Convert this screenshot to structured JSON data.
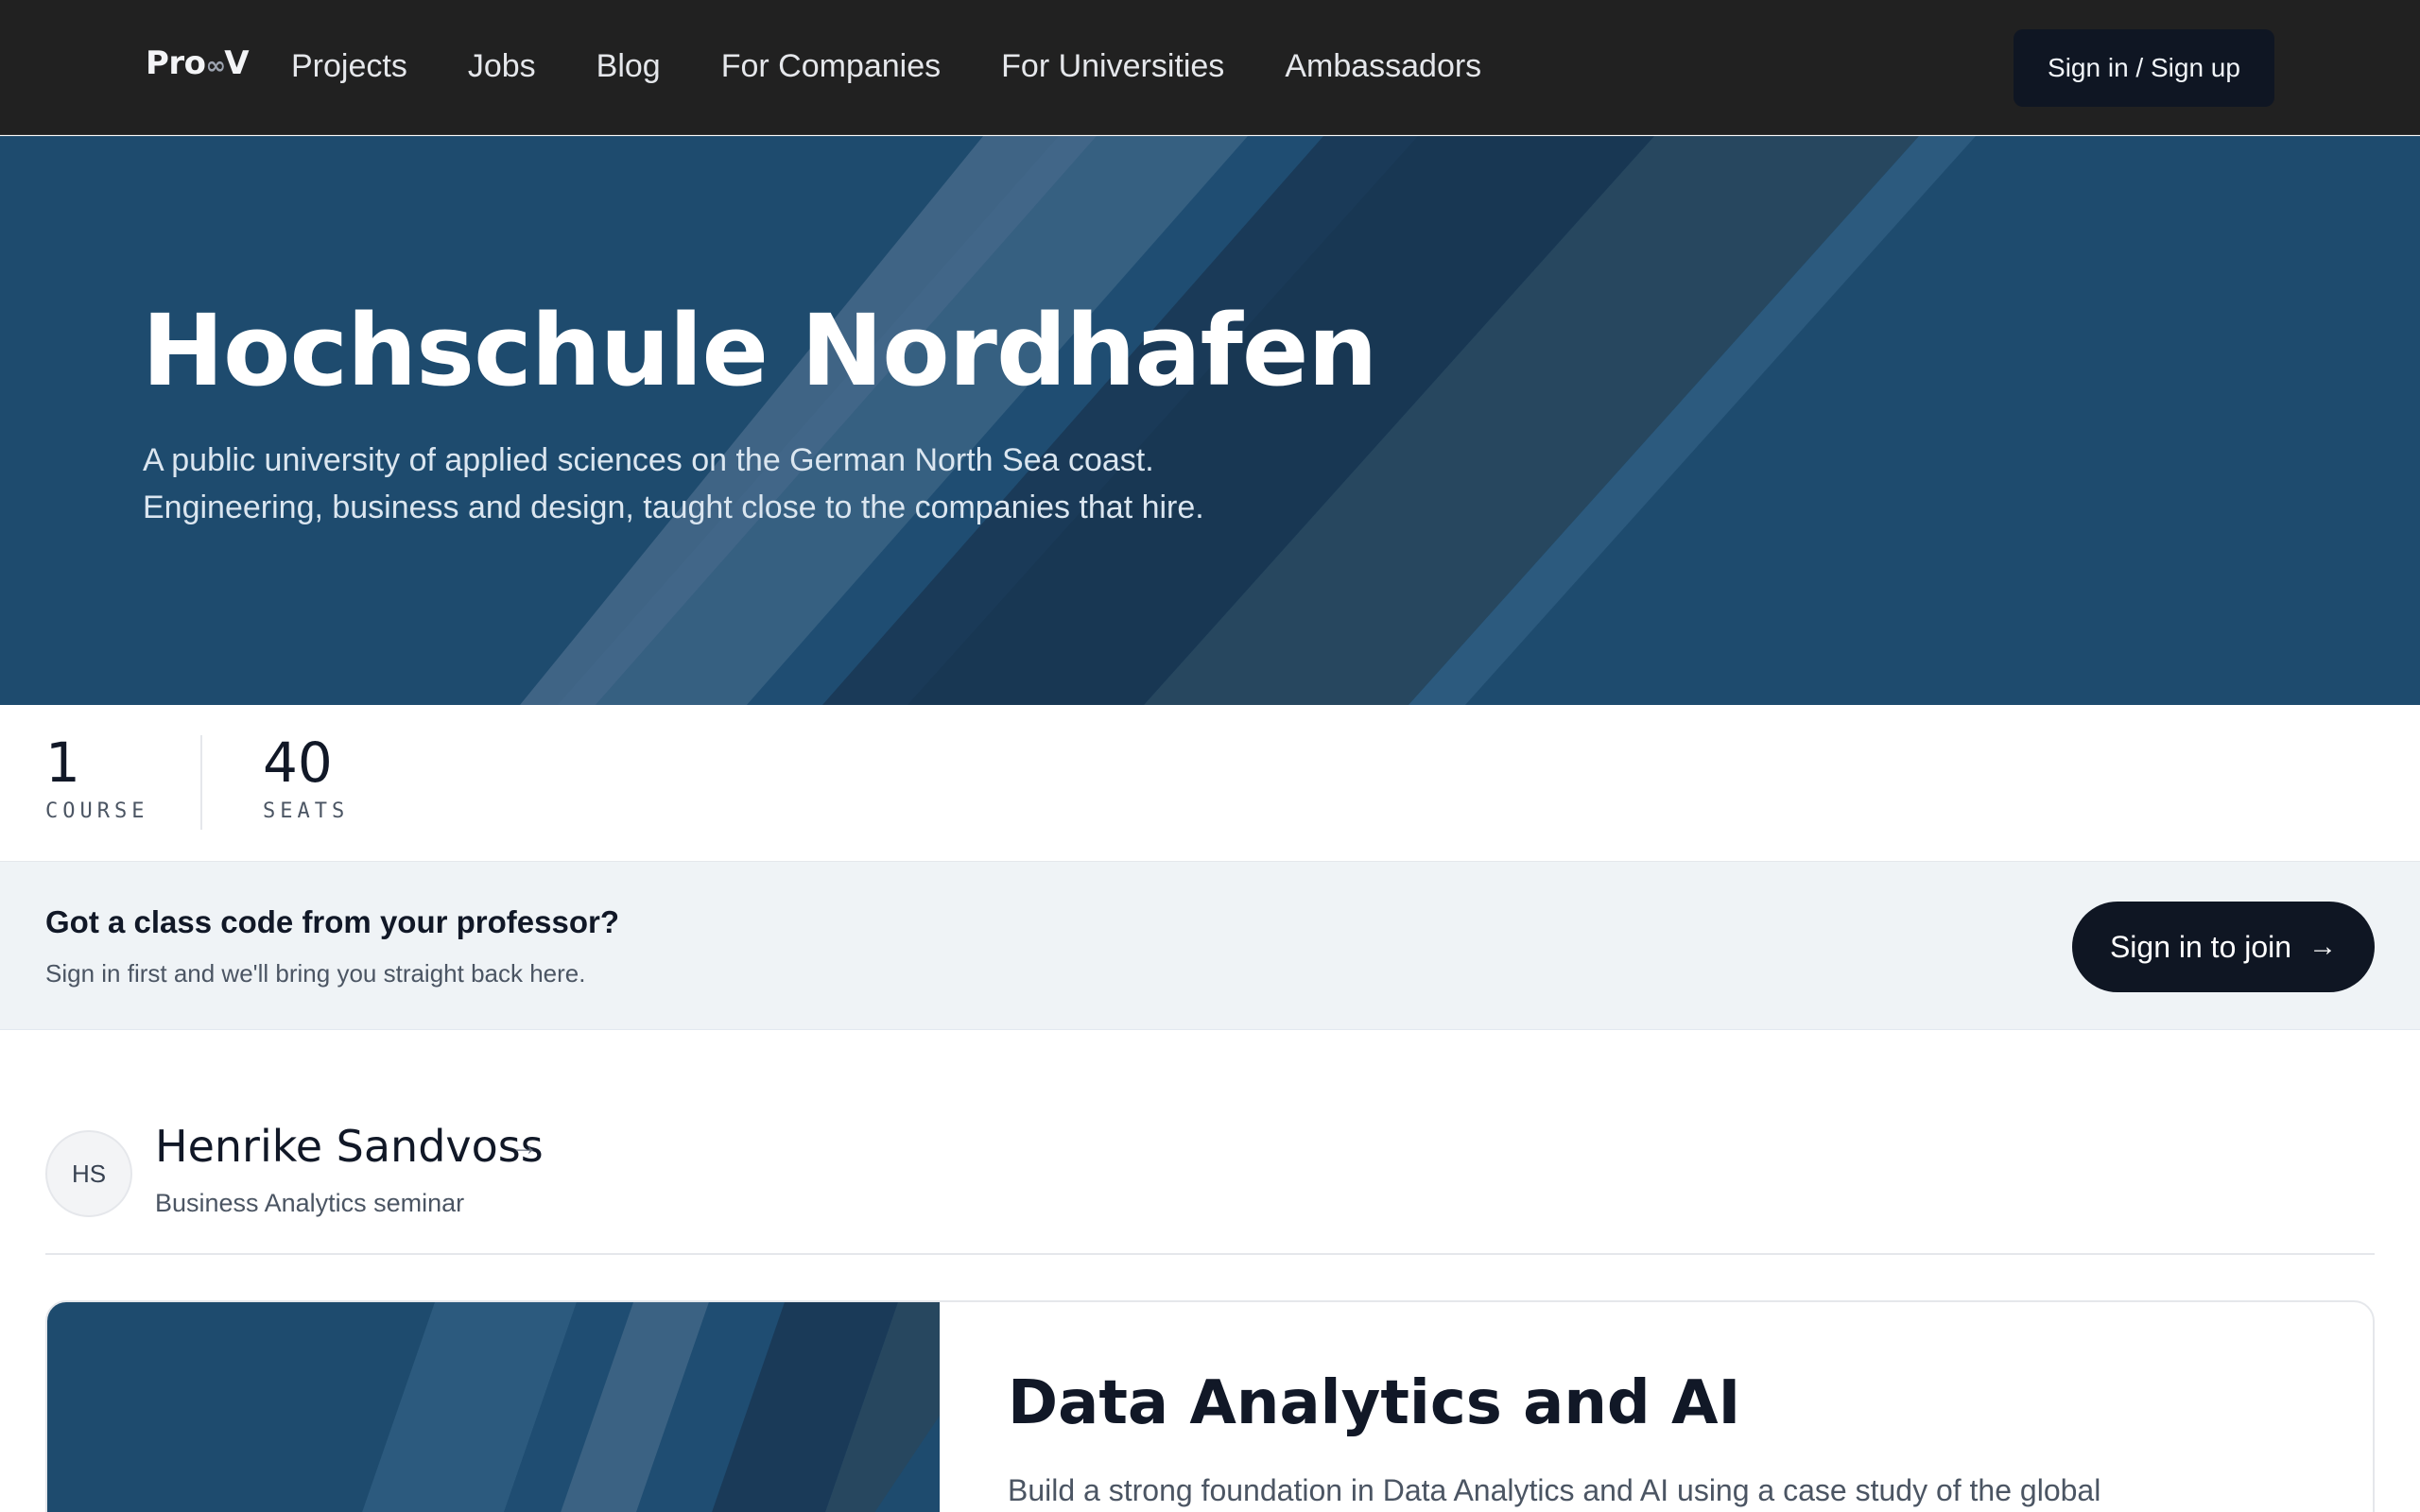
{
  "navbar": {
    "logo_left": "Pro",
    "logo_loop": "∞",
    "logo_right": "V",
    "links": [
      "Projects",
      "Jobs",
      "Blog",
      "For Companies",
      "For Universities",
      "Ambassadors"
    ],
    "signin_label": "Sign in / Sign up"
  },
  "hero": {
    "title": "Hochschule Nordhafen",
    "subtitle_line1": "A public university of applied sciences on the German North Sea coast.",
    "subtitle_line2": "Engineering, business and design, taught close to the companies that hire."
  },
  "stats": {
    "courses": {
      "value": "1",
      "label": "COURSE"
    },
    "seats": {
      "value": "40",
      "label": "SEATS"
    }
  },
  "class_code": {
    "title": "Got a class code from your professor?",
    "subtitle": "Sign in first and we'll bring you straight back here.",
    "button_label": "Sign in to join",
    "button_arrow": "→"
  },
  "instructor": {
    "initials": "HS",
    "name": "Henrike Sandvoss",
    "arrow": "→",
    "subtitle": "Business Analytics seminar"
  },
  "course": {
    "title": "Data Analytics and AI",
    "description": "Build a strong foundation in Data Analytics and AI using a case study of the global"
  },
  "colors": {
    "navbar_bg": "#212121",
    "hero_bg": "#1e4b6e",
    "primary_button": "#0f1623",
    "banner_bg": "#eff3f6"
  }
}
